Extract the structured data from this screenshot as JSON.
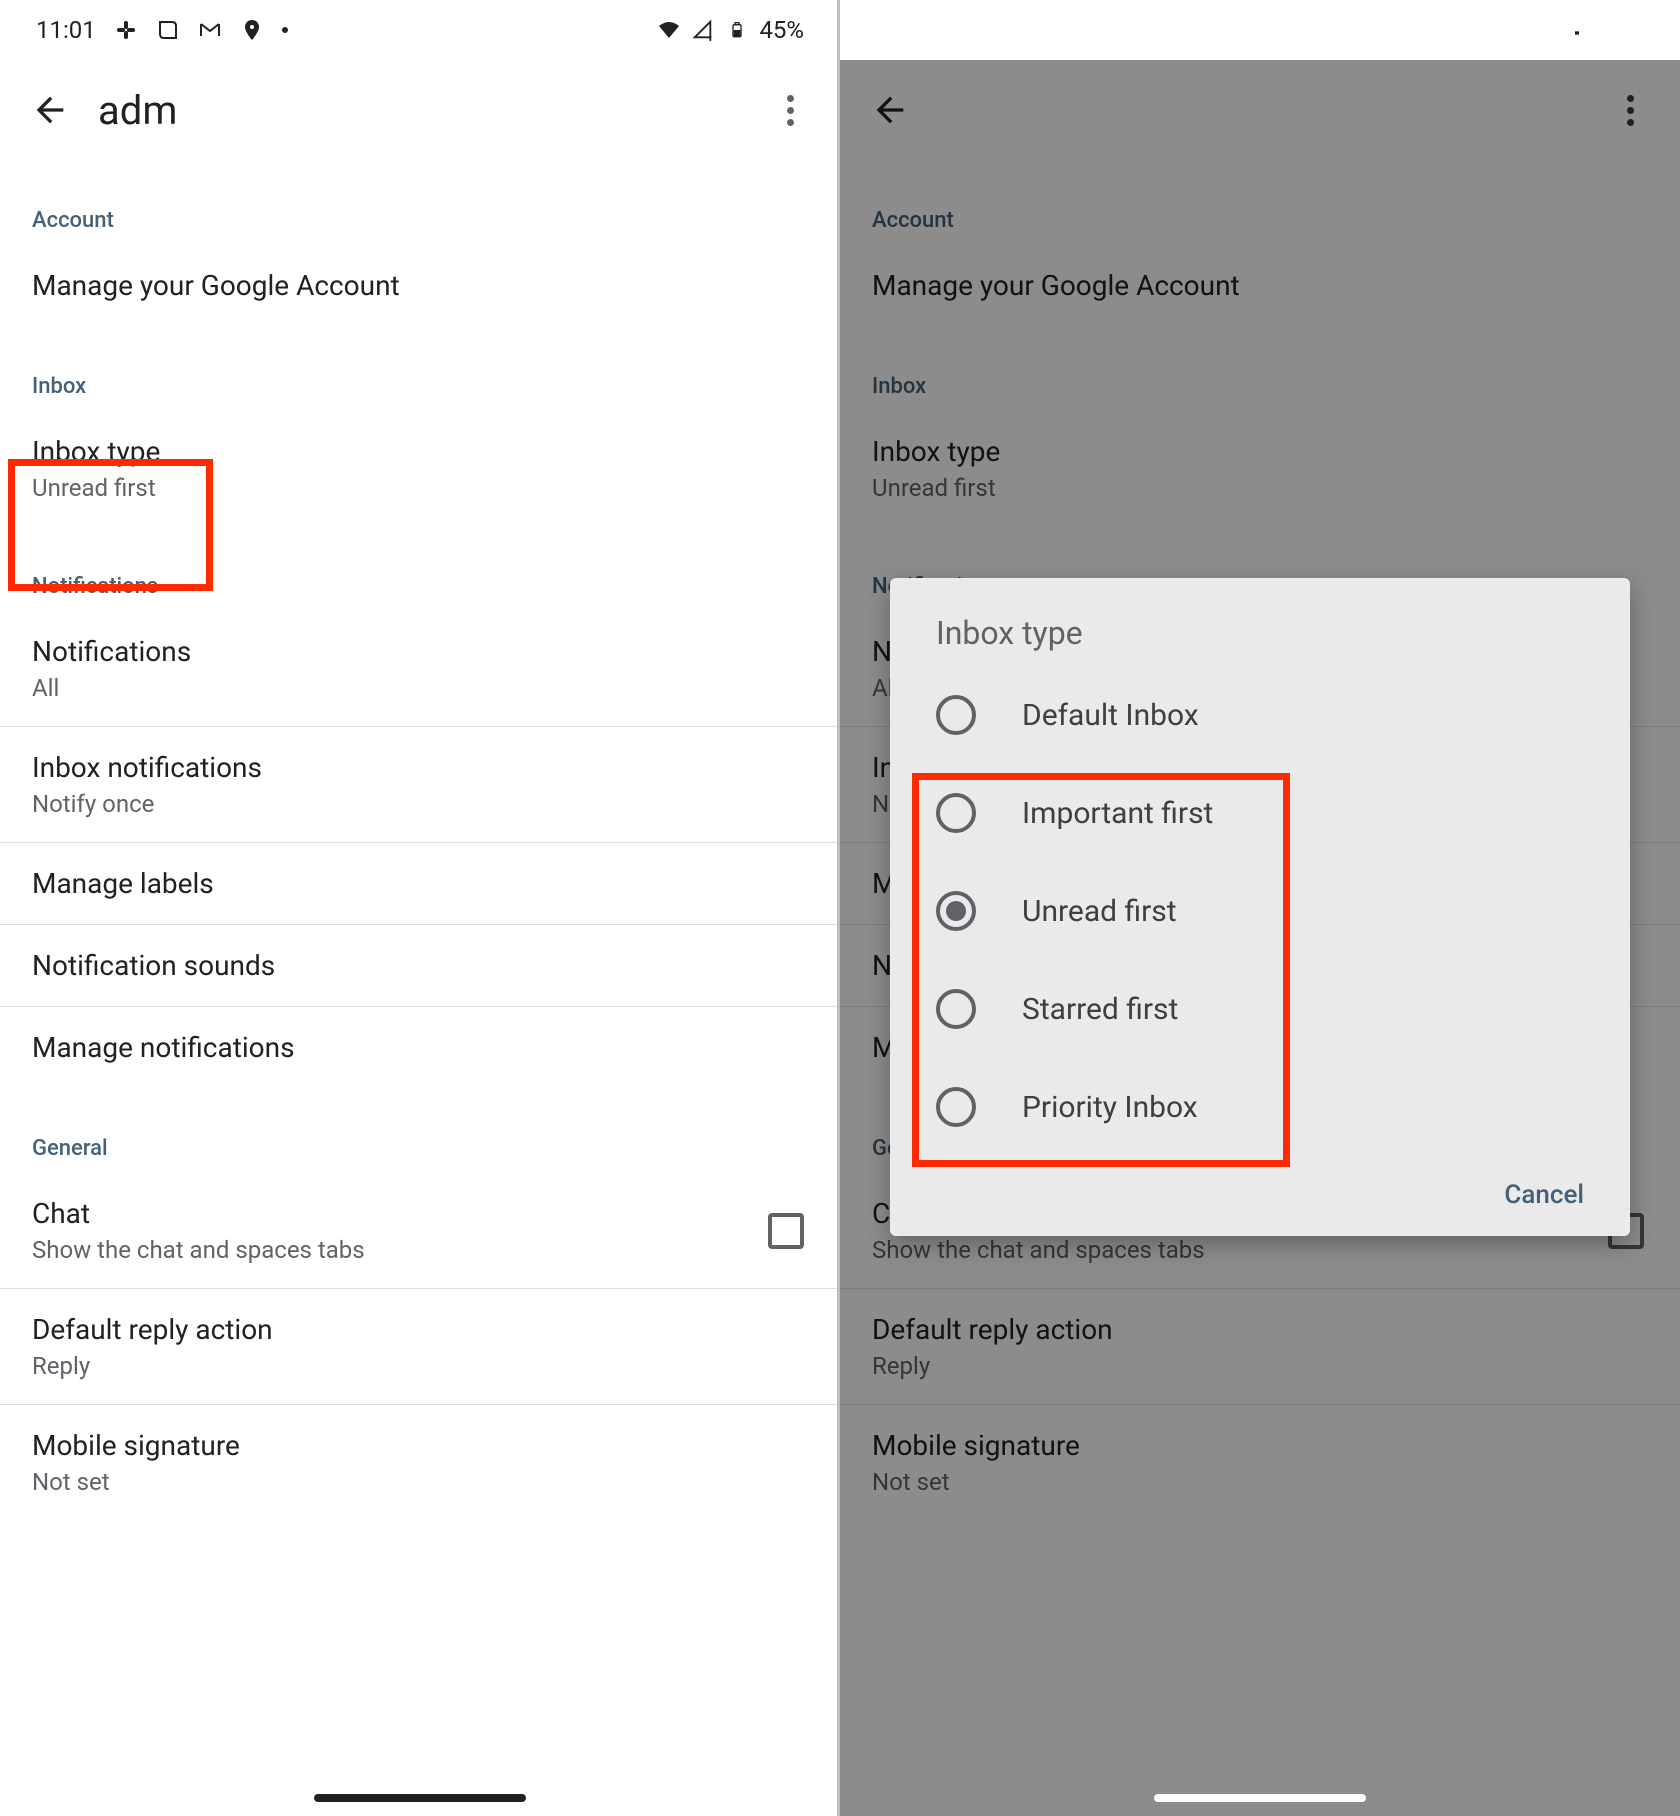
{
  "status": {
    "time": "11:01",
    "battery": "45%"
  },
  "appbar": {
    "title_truncated": "adm"
  },
  "sections": {
    "account": {
      "header": "Account",
      "manage": "Manage your Google Account"
    },
    "inbox": {
      "header": "Inbox",
      "inbox_type": {
        "title": "Inbox type",
        "sub": "Unread first"
      }
    },
    "notifications": {
      "header": "Notifications",
      "notifications": {
        "title": "Notifications",
        "sub": "All"
      },
      "inbox_notifications": {
        "title": "Inbox notifications",
        "sub": "Notify once"
      },
      "manage_labels": {
        "title": "Manage labels"
      },
      "notification_sounds": {
        "title": "Notification sounds"
      },
      "manage_notifications": {
        "title": "Manage notifications"
      }
    },
    "general": {
      "header": "General",
      "chat": {
        "title": "Chat",
        "sub": "Show the chat and spaces tabs"
      },
      "default_reply": {
        "title": "Default reply action",
        "sub": "Reply"
      },
      "mobile_signature": {
        "title": "Mobile signature",
        "sub": "Not set"
      }
    }
  },
  "dialog": {
    "title": "Inbox type",
    "options": {
      "default": "Default Inbox",
      "important": "Important first",
      "unread": "Unread first",
      "starred": "Starred first",
      "priority": "Priority Inbox"
    },
    "selected": "unread",
    "cancel": "Cancel"
  }
}
